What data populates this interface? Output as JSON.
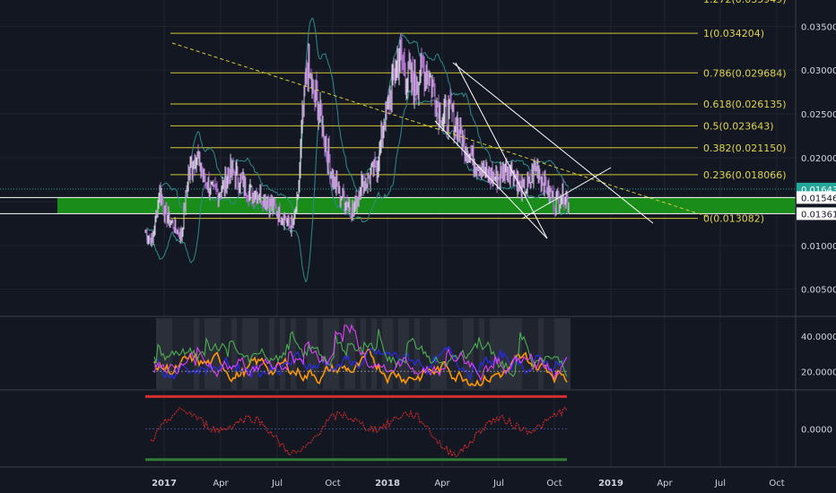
{
  "chart_data": {
    "type": "candlestick",
    "price_pane": {
      "ylim": [
        0.002,
        0.038
      ],
      "y_ticks": [
        {
          "value": 0.035,
          "label": "0.035000"
        },
        {
          "value": 0.03,
          "label": "0.030000"
        },
        {
          "value": 0.025,
          "label": "0.025000"
        },
        {
          "value": 0.02,
          "label": "0.020000"
        },
        {
          "value": 0.01,
          "label": "0.010000"
        },
        {
          "value": 0.005,
          "label": "0.005000"
        }
      ],
      "top_partial_label": "1.272(0.035949)",
      "fib_levels": [
        {
          "ratio": 1,
          "value": 0.034204,
          "label": "1(0.034204)"
        },
        {
          "ratio": 0.786,
          "value": 0.029684,
          "label": "0.786(0.029684)"
        },
        {
          "ratio": 0.618,
          "value": 0.026135,
          "label": "0.618(0.026135)"
        },
        {
          "ratio": 0.5,
          "value": 0.023643,
          "label": "0.5(0.023643)"
        },
        {
          "ratio": 0.382,
          "value": 0.02115,
          "label": "0.382(0.021150)"
        },
        {
          "ratio": 0.236,
          "value": 0.018066,
          "label": "0.236(0.018066)"
        },
        {
          "ratio": 0,
          "value": 0.013082,
          "label": "0(0.013082)"
        }
      ],
      "price_tags": [
        {
          "value": 0.016436,
          "label": "0.016436",
          "style": "teal"
        },
        {
          "value": 0.015463,
          "label": "0.015463",
          "style": "white"
        },
        {
          "value": 0.013619,
          "label": "0.013619",
          "style": "white"
        }
      ],
      "support_zone": [
        0.013619,
        0.015463
      ],
      "current_price": 0.016436,
      "candle_anchors": [
        [
          0,
          0.0115
        ],
        [
          8,
          0.0105
        ],
        [
          16,
          0.0165
        ],
        [
          22,
          0.0135
        ],
        [
          30,
          0.0125
        ],
        [
          40,
          0.011
        ],
        [
          48,
          0.018
        ],
        [
          56,
          0.0205
        ],
        [
          66,
          0.0175
        ],
        [
          76,
          0.016
        ],
        [
          86,
          0.0165
        ],
        [
          96,
          0.0185
        ],
        [
          106,
          0.0175
        ],
        [
          116,
          0.016
        ],
        [
          126,
          0.016
        ],
        [
          136,
          0.015
        ],
        [
          146,
          0.014
        ],
        [
          156,
          0.013
        ],
        [
          164,
          0.012
        ],
        [
          170,
          0.015
        ],
        [
          175,
          0.024
        ],
        [
          180,
          0.03
        ],
        [
          186,
          0.028
        ],
        [
          193,
          0.026
        ],
        [
          200,
          0.022
        ],
        [
          208,
          0.018
        ],
        [
          216,
          0.016
        ],
        [
          224,
          0.015
        ],
        [
          232,
          0.014
        ],
        [
          240,
          0.017
        ],
        [
          248,
          0.0175
        ],
        [
          258,
          0.019
        ],
        [
          266,
          0.024
        ],
        [
          272,
          0.0265
        ],
        [
          278,
          0.03
        ],
        [
          284,
          0.032
        ],
        [
          290,
          0.0295
        ],
        [
          296,
          0.029
        ],
        [
          302,
          0.0285
        ],
        [
          310,
          0.03
        ],
        [
          318,
          0.029
        ],
        [
          326,
          0.026
        ],
        [
          334,
          0.0245
        ],
        [
          342,
          0.025
        ],
        [
          350,
          0.023
        ],
        [
          358,
          0.021
        ],
        [
          366,
          0.02
        ],
        [
          374,
          0.019
        ],
        [
          382,
          0.018
        ],
        [
          392,
          0.0175
        ],
        [
          402,
          0.019
        ],
        [
          410,
          0.0185
        ],
        [
          418,
          0.0165
        ],
        [
          426,
          0.0165
        ],
        [
          436,
          0.019
        ],
        [
          446,
          0.017
        ],
        [
          456,
          0.015
        ],
        [
          466,
          0.016
        ],
        [
          472,
          0.0148
        ]
      ]
    },
    "dmi_pane": {
      "ylim": [
        10,
        50
      ],
      "y_ticks": [
        {
          "value": 40,
          "label": "40.0000"
        },
        {
          "value": 20,
          "label": "20.0000"
        }
      ],
      "series": [
        {
          "color": "#ff9800"
        },
        {
          "color": "#2a2aff"
        },
        {
          "color": "#4caf50"
        },
        {
          "color": "#e040fb"
        }
      ]
    },
    "osc_pane": {
      "ylim": [
        -1.15,
        1.15
      ],
      "y_ticks": [
        {
          "value": 0,
          "label": "0.0000"
        }
      ],
      "upper_band": 1.0,
      "lower_band": -0.95
    },
    "x_axis": {
      "ticks": [
        {
          "label": "2017",
          "bold": true
        },
        {
          "label": "Apr",
          "bold": false
        },
        {
          "label": "Jul",
          "bold": false
        },
        {
          "label": "Oct",
          "bold": false
        },
        {
          "label": "2018",
          "bold": true
        },
        {
          "label": "Apr",
          "bold": false
        },
        {
          "label": "Jul",
          "bold": false
        },
        {
          "label": "Oct",
          "bold": false
        },
        {
          "label": "2019",
          "bold": true
        },
        {
          "label": "Apr",
          "bold": false
        },
        {
          "label": "Jul",
          "bold": false
        },
        {
          "label": "Oct",
          "bold": false
        }
      ]
    },
    "colors": {
      "background": "#131722",
      "grid": "#1f2431",
      "fib": "#d4c832",
      "fib_label": "#e0d44e",
      "trend_dashed": "#d8cc3a",
      "support_fill": "#1a8c1a",
      "candle_up": "#d0d0d8",
      "candle_down": "#b070d0",
      "bollinger": "#2e8b8b",
      "accent_teal": "#26a69a",
      "osc_line": "#c62828",
      "osc_upper": "#d32f2f",
      "osc_lower": "#2e7d32",
      "axis_text": "#d1d4dc"
    }
  }
}
